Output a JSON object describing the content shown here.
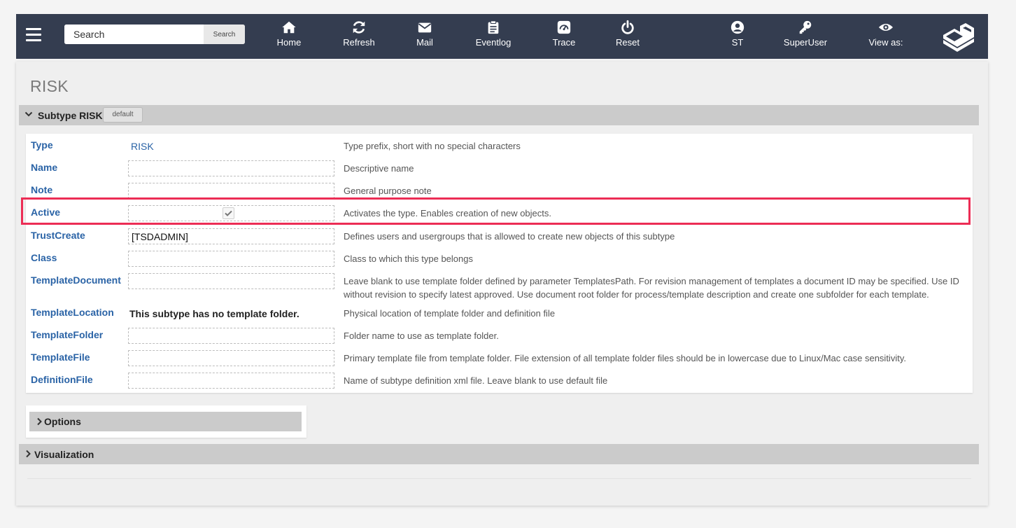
{
  "topbar": {
    "search": {
      "placeholder": "Search",
      "button_label": "Search"
    },
    "nav": [
      {
        "key": "home",
        "label": "Home",
        "icon": "home-icon"
      },
      {
        "key": "refresh",
        "label": "Refresh",
        "icon": "refresh-icon"
      },
      {
        "key": "mail",
        "label": "Mail",
        "icon": "mail-icon"
      },
      {
        "key": "eventlog",
        "label": "Eventlog",
        "icon": "clipboard-icon"
      },
      {
        "key": "trace",
        "label": "Trace",
        "icon": "gauge-icon"
      },
      {
        "key": "reset",
        "label": "Reset",
        "icon": "power-icon"
      },
      {
        "key": "user",
        "label": "ST",
        "icon": "user-icon"
      },
      {
        "key": "superuser",
        "label": "SuperUser",
        "icon": "key-icon"
      },
      {
        "key": "viewas",
        "label": "View as:",
        "icon": "eye-icon"
      }
    ],
    "colors": {
      "bar": "#343d50",
      "text": "#ffffff"
    }
  },
  "page": {
    "title": "RISK",
    "subtype_section": {
      "title": "Subtype RISK",
      "badge": "default",
      "expanded": true
    },
    "fields": [
      {
        "label": "Type",
        "kind": "text",
        "value": "RISK",
        "help": "Type prefix, short with no special characters"
      },
      {
        "label": "Name",
        "kind": "input",
        "value": "",
        "help": "Descriptive name"
      },
      {
        "label": "Note",
        "kind": "input",
        "value": "",
        "help": "General purpose note"
      },
      {
        "label": "Active",
        "kind": "checkbox",
        "checked": true,
        "help": "Activates the type. Enables creation of new objects."
      },
      {
        "label": "TrustCreate",
        "kind": "input",
        "value": "[TSDADMIN]",
        "help": "Defines users and usergroups that is allowed to create new objects of this subtype"
      },
      {
        "label": "Class",
        "kind": "input",
        "value": "",
        "help": "Class to which this type belongs"
      },
      {
        "label": "TemplateDocument",
        "kind": "input",
        "value": "",
        "help": "Leave blank to use template folder defined by parameter TemplatesPath. For revision management of templates a document ID may be specified. Use ID without revision to specify latest approved. Use document root folder for process/template description and create one subfolder for each template."
      },
      {
        "label": "TemplateLocation",
        "kind": "static",
        "value": "This subtype has no template folder.",
        "help": "Physical location of template folder and definition file"
      },
      {
        "label": "TemplateFolder",
        "kind": "input",
        "value": "",
        "help": "Folder name to use as template folder."
      },
      {
        "label": "TemplateFile",
        "kind": "input",
        "value": "",
        "help": "Primary template file from template folder. File extension of all template folder files should be in lowercase due to Linux/Mac case sensitivity."
      },
      {
        "label": "DefinitionFile",
        "kind": "input",
        "value": "",
        "help": "Name of subtype definition xml file. Leave blank to use default file"
      }
    ],
    "options_section": {
      "title": "Options",
      "expanded": false
    },
    "visualization_section": {
      "title": "Visualization",
      "expanded": false
    },
    "colors": {
      "label": "#2a63a6",
      "highlight": "#ec2d55",
      "section_header": "#cbcbcb"
    }
  }
}
